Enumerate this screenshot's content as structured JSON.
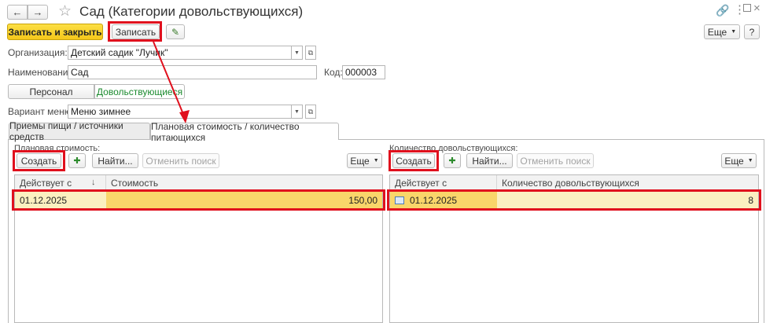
{
  "window": {
    "title": "Сад (Категории довольствующихся)"
  },
  "toolbar": {
    "save_close": "Записать и закрыть",
    "save": "Записать",
    "more": "Еще",
    "help": "?"
  },
  "form": {
    "org_label": "Организация:",
    "org_value": "Детский садик \"Лучик\"",
    "name_label": "Наименование:",
    "name_value": "Сад",
    "code_label": "Код:",
    "code_value": "000003",
    "menu_label": "Вариант меню:",
    "menu_value": "Меню зимнее"
  },
  "switch": {
    "personnel": "Персонал",
    "dependents": "Довольствующиеся"
  },
  "tabs": {
    "meals": "Приемы пищи / источники средств",
    "planned": "Плановая стоимость / количество питающихся"
  },
  "left": {
    "title": "Плановая стоимость:",
    "create": "Создать",
    "find": "Найти...",
    "cancel_search": "Отменить поиск",
    "more": "Еще",
    "col_date": "Действует с",
    "col_value": "Стоимость",
    "rows": [
      {
        "date": "01.12.2025",
        "value": "150,00"
      }
    ]
  },
  "right": {
    "title": "Количество довольствующихся:",
    "create": "Создать",
    "find": "Найти...",
    "cancel_search": "Отменить поиск",
    "more": "Еще",
    "col_date": "Действует с",
    "col_value": "Количество довольствующихся",
    "rows": [
      {
        "date": "01.12.2025",
        "value": "8"
      }
    ]
  },
  "colors": {
    "accent_yellow": "#f5c71a",
    "highlight_red": "#e0101d",
    "selected_row": "#fbf0c0",
    "selected_cell": "#f9d66a",
    "green_text": "#1b8a2e"
  }
}
